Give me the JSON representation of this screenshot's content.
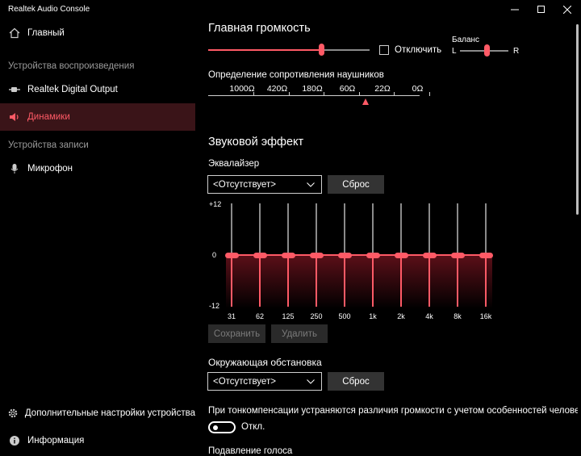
{
  "window": {
    "title": "Realtek Audio Console",
    "minimize_icon": "minimize-icon",
    "maximize_icon": "maximize-icon",
    "close_icon": "close-icon"
  },
  "sidebar": {
    "home": {
      "label": "Главный",
      "icon": "home-icon"
    },
    "playback_header": "Устройства воспроизведения",
    "playback_items": [
      {
        "label": "Realtek Digital Output",
        "icon": "digital-output-icon",
        "active": false
      },
      {
        "label": "Динамики",
        "icon": "speaker-icon",
        "active": true
      }
    ],
    "recording_header": "Устройства записи",
    "recording_items": [
      {
        "label": "Микрофон",
        "icon": "microphone-icon",
        "active": false
      }
    ],
    "bottom_items": [
      {
        "label": "Дополнительные настройки устройства",
        "icon": "gear-icon"
      },
      {
        "label": "Информация",
        "icon": "info-icon"
      }
    ]
  },
  "main": {
    "volume": {
      "title": "Главная громкость",
      "level": 0.7,
      "mute_label": "Отключить",
      "mute_checked": false,
      "balance_label": "Баланс",
      "balance_left": "L",
      "balance_right": "R",
      "balance_level": 0.55
    },
    "impedance": {
      "title": "Определение сопротивления наушников",
      "ticks": [
        "1000Ω",
        "420Ω",
        "180Ω",
        "60Ω",
        "22Ω",
        "0Ω"
      ],
      "marker_position": 3.5
    },
    "sound_effect": {
      "title": "Звуковой эффект",
      "equalizer_label": "Эквалайзер",
      "equalizer_preset": "<Отсутствует>",
      "reset_label": "Сброс",
      "level_top": "+12",
      "level_mid": "0",
      "level_bottom": "-12",
      "bands": [
        "31",
        "62",
        "125",
        "250",
        "500",
        "1k",
        "2k",
        "4k",
        "8k",
        "16k"
      ],
      "band_values": [
        0,
        0,
        0,
        0,
        0,
        0,
        0,
        0,
        0,
        0
      ],
      "save_label": "Сохранить",
      "delete_label": "Удалить"
    },
    "environment": {
      "title": "Окружающая обстановка",
      "preset": "<Отсутствует>",
      "reset_label": "Сброс"
    },
    "loudness": {
      "description": "При тонкомпенсации устраняются различия громкости с учетом особенностей человеческого",
      "toggle_label": "Откл.",
      "toggle_on": false
    },
    "voice_suppression_title": "Подавление голоса"
  },
  "colors": {
    "accent": "#ff5a66",
    "active_bg": "#3a1418",
    "button_bg": "#333333"
  }
}
